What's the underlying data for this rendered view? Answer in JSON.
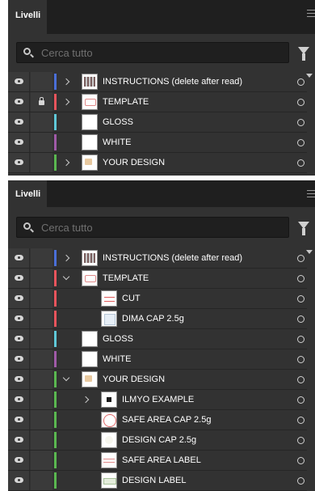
{
  "colors": {
    "panel_bg": "#323232",
    "tabbar_bg": "#1f1f1f",
    "blue": "#4a6fd8",
    "red": "#e8545c",
    "cyan": "#5fc8d8",
    "purple": "#a05aa8",
    "green": "#5ab850"
  },
  "panel_a": {
    "tab_label": "Livelli",
    "search_placeholder": "Cerca tutto",
    "layers": [
      {
        "label": "INSTRUCTIONS (delete after read)",
        "color": "#4a6fd8",
        "locked": false,
        "expander": "right",
        "thumb": "instr",
        "indent": 0
      },
      {
        "label": "TEMPLATE",
        "color": "#e8545c",
        "locked": true,
        "expander": "right",
        "thumb": "template",
        "indent": 0
      },
      {
        "label": "GLOSS",
        "color": "#5fc8d8",
        "locked": false,
        "expander": "none",
        "thumb": "blank",
        "indent": 0
      },
      {
        "label": "WHITE",
        "color": "#a05aa8",
        "locked": false,
        "expander": "none",
        "thumb": "blank",
        "indent": 0
      },
      {
        "label": "YOUR DESIGN",
        "color": "#5ab850",
        "locked": false,
        "expander": "right",
        "thumb": "your",
        "indent": 0
      }
    ]
  },
  "panel_b": {
    "tab_label": "Livelli",
    "search_placeholder": "Cerca tutto",
    "layers": [
      {
        "label": "INSTRUCTIONS (delete after read)",
        "color": "#4a6fd8",
        "locked": false,
        "expander": "right",
        "thumb": "instr",
        "indent": 0
      },
      {
        "label": "TEMPLATE",
        "color": "#e8545c",
        "locked": false,
        "expander": "down",
        "thumb": "template",
        "indent": 0
      },
      {
        "label": "CUT",
        "color": "#e8545c",
        "locked": false,
        "expander": "none",
        "thumb": "cut",
        "indent": 1
      },
      {
        "label": "DIMA CAP 2.5g",
        "color": "#e8545c",
        "locked": false,
        "expander": "none",
        "thumb": "dima",
        "indent": 1
      },
      {
        "label": "GLOSS",
        "color": "#5fc8d8",
        "locked": false,
        "expander": "none",
        "thumb": "blank",
        "indent": 0
      },
      {
        "label": "WHITE",
        "color": "#a05aa8",
        "locked": false,
        "expander": "none",
        "thumb": "blank",
        "indent": 0
      },
      {
        "label": "YOUR DESIGN",
        "color": "#5ab850",
        "locked": false,
        "expander": "down",
        "thumb": "your",
        "indent": 0
      },
      {
        "label": "ILMYO EXAMPLE",
        "color": "#5ab850",
        "locked": false,
        "expander": "right",
        "thumb": "ilmyo",
        "indent": 1
      },
      {
        "label": "SAFE AREA CAP 2.5g",
        "color": "#5ab850",
        "locked": false,
        "expander": "none",
        "thumb": "safecap",
        "indent": 1
      },
      {
        "label": "DESIGN CAP 2.5g",
        "color": "#5ab850",
        "locked": false,
        "expander": "none",
        "thumb": "designcap",
        "indent": 1
      },
      {
        "label": "SAFE AREA LABEL",
        "color": "#5ab850",
        "locked": false,
        "expander": "none",
        "thumb": "safelabel",
        "indent": 1
      },
      {
        "label": "DESIGN LABEL",
        "color": "#5ab850",
        "locked": false,
        "expander": "none",
        "thumb": "designlabel",
        "indent": 1
      }
    ]
  }
}
